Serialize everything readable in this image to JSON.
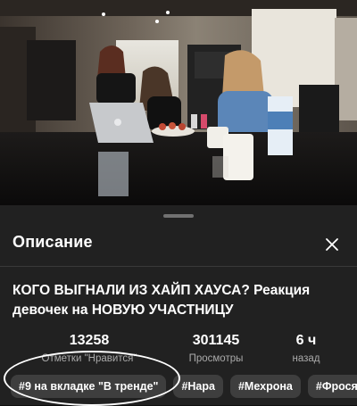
{
  "sheet": {
    "title": "Описание",
    "close_icon": "close-icon"
  },
  "video": {
    "title": "КОГО ВЫГНАЛИ ИЗ ХАЙП ХАУСА? Реакция девочек на НОВУЮ УЧАСТНИЦУ",
    "stats": [
      {
        "value": "13258",
        "label": "Отметки \"Нравится\""
      },
      {
        "value": "301145",
        "label": "Просмотры"
      },
      {
        "value": "6 ч",
        "label": "назад"
      }
    ],
    "chips": [
      "#9 на вкладке \"В тренде\"",
      "#Нара",
      "#Мехрона",
      "#Фрося"
    ]
  },
  "colors": {
    "sheet_bg": "#212121",
    "chip_bg": "#3e3e3e",
    "secondary_text": "#aaaaaa"
  }
}
